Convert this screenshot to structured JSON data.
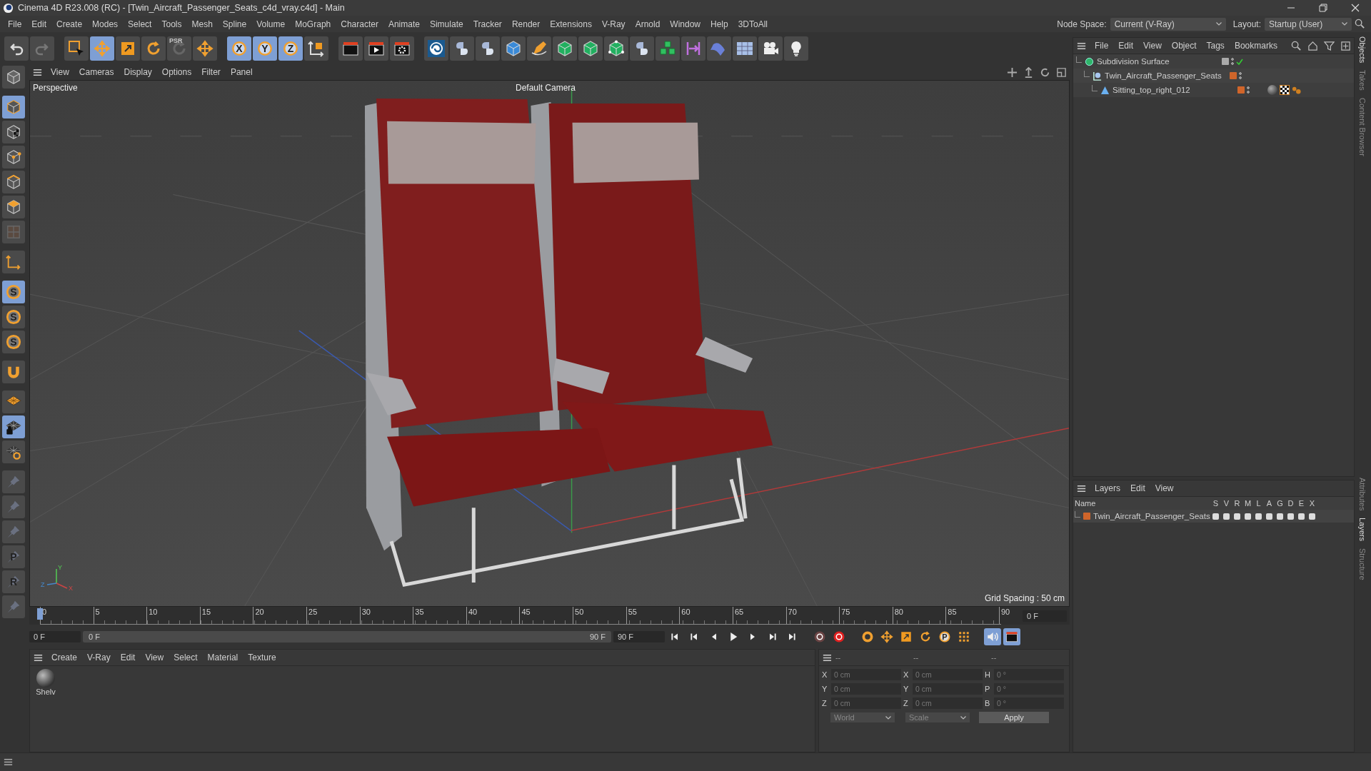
{
  "window": {
    "title": "Cinema 4D R23.008 (RC) - [Twin_Aircraft_Passenger_Seats_c4d_vray.c4d] - Main"
  },
  "menu": [
    "File",
    "Edit",
    "Create",
    "Modes",
    "Select",
    "Tools",
    "Mesh",
    "Spline",
    "Volume",
    "MoGraph",
    "Character",
    "Animate",
    "Simulate",
    "Tracker",
    "Render",
    "Extensions",
    "V-Ray",
    "Arnold",
    "Window",
    "Help",
    "3DToAll"
  ],
  "node_space": {
    "label": "Node Space:",
    "value": "Current (V-Ray)"
  },
  "layout": {
    "label": "Layout:",
    "value": "Startup (User)"
  },
  "toolbar": [
    {
      "kind": "undo",
      "selected": false
    },
    {
      "kind": "redo",
      "selected": false
    },
    {
      "kind": "select",
      "selected": false
    },
    {
      "kind": "move",
      "selected": true
    },
    {
      "kind": "scale",
      "selected": false
    },
    {
      "kind": "rotate",
      "selected": false
    },
    {
      "kind": "psr",
      "label": "PSR",
      "selected": false
    },
    {
      "kind": "move",
      "selected": false
    },
    {
      "kind": "axis-letter",
      "label": "X",
      "selected": true
    },
    {
      "kind": "axis-letter",
      "label": "Y",
      "selected": true
    },
    {
      "kind": "axis-letter",
      "label": "Z",
      "selected": true
    },
    {
      "kind": "coord",
      "selected": false
    },
    {
      "kind": "clapper",
      "selected": false
    },
    {
      "kind": "render",
      "selected": false
    },
    {
      "kind": "render-settings",
      "selected": false
    },
    {
      "kind": "swirl",
      "selected": false
    },
    {
      "kind": "plugin",
      "selected": false
    },
    {
      "kind": "plugin",
      "selected": false
    },
    {
      "kind": "cube",
      "selected": false
    },
    {
      "kind": "pen",
      "selected": false
    },
    {
      "kind": "green-cube",
      "selected": false
    },
    {
      "kind": "green-cube",
      "selected": false
    },
    {
      "kind": "nodes",
      "selected": false
    },
    {
      "kind": "plugin",
      "selected": false
    },
    {
      "kind": "cubes",
      "selected": false
    },
    {
      "kind": "ruler",
      "selected": false
    },
    {
      "kind": "deform",
      "selected": false
    },
    {
      "kind": "floor",
      "selected": false
    },
    {
      "kind": "camera",
      "selected": false
    },
    {
      "kind": "light",
      "selected": false
    }
  ],
  "left_toolbar": [
    {
      "kind": "dim-cube",
      "selected": false
    },
    {
      "kind": "model",
      "selected": true
    },
    {
      "kind": "texture",
      "selected": false
    },
    {
      "kind": "points",
      "selected": false
    },
    {
      "kind": "edges",
      "selected": false
    },
    {
      "kind": "polygons",
      "selected": false
    },
    {
      "kind": "uv",
      "selected": false
    },
    {
      "kind": "axis",
      "selected": false
    },
    {
      "kind": "snap",
      "label": "S",
      "selected": true
    },
    {
      "kind": "snap",
      "label": "S",
      "selected": false
    },
    {
      "kind": "snap",
      "label": "S",
      "selected": false
    },
    {
      "kind": "magnet",
      "selected": false
    },
    {
      "kind": "grid",
      "selected": false
    },
    {
      "kind": "grid-lock",
      "selected": true
    },
    {
      "kind": "grid-rotate",
      "selected": false
    },
    {
      "kind": "pin",
      "selected": false
    },
    {
      "kind": "pin",
      "selected": false
    },
    {
      "kind": "pin",
      "selected": false
    },
    {
      "kind": "pin",
      "label": "P",
      "selected": false
    },
    {
      "kind": "pin",
      "label": "R",
      "selected": false
    },
    {
      "kind": "pin",
      "selected": false
    }
  ],
  "viewport": {
    "menu": [
      "View",
      "Cameras",
      "Display",
      "Options",
      "Filter",
      "Panel"
    ],
    "label": "Perspective",
    "camera": "Default Camera",
    "grid_spacing": "Grid Spacing : 50 cm",
    "axis_labels": [
      "Y",
      "Z",
      "X"
    ]
  },
  "timeline": {
    "ticks": [
      "0",
      "5",
      "10",
      "15",
      "20",
      "25",
      "30",
      "35",
      "40",
      "45",
      "50",
      "55",
      "60",
      "65",
      "70",
      "75",
      "80",
      "85",
      "90"
    ],
    "current_frame": "0 F",
    "start": "0 F",
    "range": {
      "start": "0 F",
      "end": "90 F",
      "level": 1
    },
    "end": "90 F"
  },
  "transport": [
    {
      "kind": "first"
    },
    {
      "kind": "prev-key"
    },
    {
      "kind": "prev"
    },
    {
      "kind": "play"
    },
    {
      "kind": "next"
    },
    {
      "kind": "next-key"
    },
    {
      "kind": "last"
    },
    {
      "kind": "record-dim"
    },
    {
      "kind": "record"
    },
    {
      "kind": "key"
    },
    {
      "kind": "move"
    },
    {
      "kind": "scale"
    },
    {
      "kind": "rotate"
    },
    {
      "kind": "param",
      "label": "P"
    },
    {
      "kind": "dots"
    },
    {
      "kind": "sound"
    },
    {
      "kind": "film"
    }
  ],
  "materials": {
    "menu": [
      "Create",
      "V-Ray",
      "Edit",
      "View",
      "Select",
      "Material",
      "Texture"
    ],
    "items": [
      {
        "name": "Shelv"
      }
    ]
  },
  "coordinates": {
    "headers": [
      "--",
      "--",
      "--"
    ],
    "rows": [
      {
        "axis": "X",
        "position": "0 cm",
        "size_axis": "X",
        "size": "0 cm",
        "rotation_axis": "H",
        "rotation": "0 °"
      },
      {
        "axis": "Y",
        "position": "0 cm",
        "size_axis": "Y",
        "size": "0 cm",
        "rotation_axis": "P",
        "rotation": "0 °"
      },
      {
        "axis": "Z",
        "position": "0 cm",
        "size_axis": "Z",
        "size": "0 cm",
        "rotation_axis": "B",
        "rotation": "0 °"
      }
    ],
    "mode": "World",
    "size_mode": "Scale",
    "apply": "Apply"
  },
  "objects": {
    "menu": [
      "File",
      "Edit",
      "View",
      "Object",
      "Tags",
      "Bookmarks"
    ],
    "tree": [
      {
        "name": "Subdivision Surface",
        "kind": "subdivision",
        "enabled": true,
        "children": [
          {
            "name": "Twin_Aircraft_Passenger_Seats",
            "kind": "null",
            "color": "#d0652a",
            "children": [
              {
                "name": "Sitting_top_right_012",
                "kind": "polygon",
                "color": "#d0652a",
                "tags": true
              }
            ]
          }
        ]
      }
    ]
  },
  "layers": {
    "menu": [
      "Layers",
      "Edit",
      "View"
    ],
    "columns": [
      "Name",
      "S",
      "V",
      "R",
      "M",
      "L",
      "A",
      "G",
      "D",
      "E",
      "X"
    ],
    "rows": [
      {
        "name": "Twin_Aircraft_Passenger_Seats",
        "color": "#d0652a"
      }
    ]
  },
  "side_tabs": [
    {
      "label": "Objects",
      "selected": true
    },
    {
      "label": "Takes",
      "selected": false
    },
    {
      "label": "Content Browser",
      "selected": false
    },
    {
      "label": "Attributes",
      "selected": false
    },
    {
      "label": "Layers",
      "selected": true
    },
    {
      "label": "Structure",
      "selected": false
    }
  ]
}
